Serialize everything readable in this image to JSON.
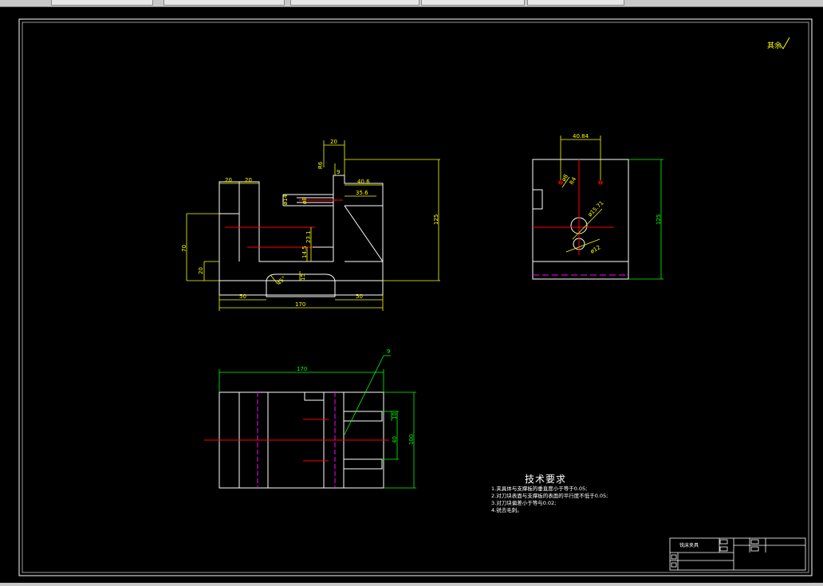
{
  "tabs": [
    "",
    "",
    "",
    "",
    ""
  ],
  "drawing": {
    "signature_mark": "其余",
    "front_view": {
      "dims": {
        "d20_top": "20",
        "d20_a": "20",
        "d20_b": "20",
        "d9": "9",
        "d40_6": "40.6",
        "d35_6": "35.6",
        "d125": "125",
        "phi14": "ø14",
        "phi8": "ø8",
        "d70": "70",
        "d20_left": "20",
        "d23_1": "23.1",
        "d14_5": "14.5",
        "d50_left": "50",
        "d50_right": "50",
        "d170": "170",
        "d15": "15",
        "d45": "45°",
        "small_label": "R6"
      }
    },
    "side_view": {
      "dims": {
        "d40_84": "40.84",
        "d125": "125",
        "phi15_71": "ø15.71",
        "phi12": "ø12",
        "hole_a": "ø8",
        "hole_b": "R4"
      }
    },
    "top_view": {
      "dims": {
        "d170": "170",
        "d100": "100",
        "d40": "40",
        "d10": "10",
        "leader": "9"
      }
    },
    "tech_requirements": {
      "title": "技术要求",
      "lines": [
        "1.夹具体与支撑板的垂直度小于等于0.05;",
        "2.对刀块表面与支撑板的表面的平行度不低于0.05;",
        "3.对刀块偏差小于等与0.02;",
        "4.锐去毛刺。"
      ]
    },
    "title_block": {
      "name": "铣床夹具",
      "cells": [
        "",
        "",
        "",
        "",
        "",
        ""
      ]
    }
  },
  "colors": {
    "outline": "#ffffff",
    "dimension": "#ffff00",
    "centerline": "#ff0000",
    "side_dimension": "#00ff00",
    "hidden": "#ff00ff"
  }
}
